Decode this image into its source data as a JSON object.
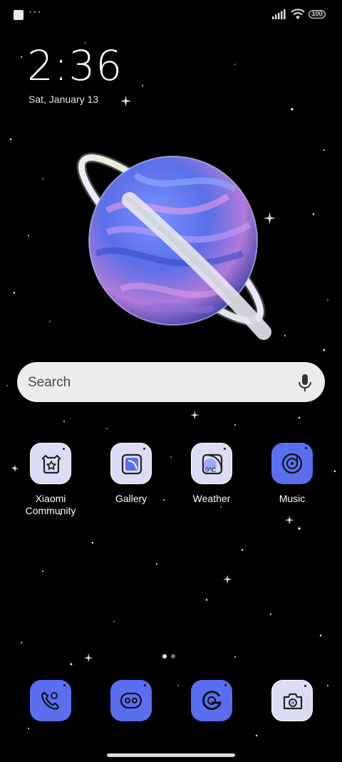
{
  "status_bar": {
    "overflow_dots": "···",
    "battery": "100",
    "icons": [
      "notification-square-icon",
      "signal-icon",
      "wifi-icon",
      "battery-icon"
    ]
  },
  "clock": {
    "time": "2:36",
    "date": "Sat, January 13"
  },
  "search": {
    "placeholder": "Search",
    "icon": "mic-icon"
  },
  "apps": [
    {
      "label": "Xiaomi Community",
      "icon": "xiaomi-community-icon",
      "style": "light"
    },
    {
      "label": "Gallery",
      "icon": "gallery-icon",
      "style": "light"
    },
    {
      "label": "Weather",
      "icon": "weather-icon",
      "style": "light",
      "badge": "0°C"
    },
    {
      "label": "Music",
      "icon": "music-icon",
      "style": "blue"
    }
  ],
  "dock": [
    {
      "icon": "phone-icon",
      "style": "blue"
    },
    {
      "icon": "messages-icon",
      "style": "blue"
    },
    {
      "icon": "chrome-icon",
      "style": "blue"
    },
    {
      "icon": "camera-icon",
      "style": "light"
    }
  ],
  "pages": {
    "total": 2,
    "current": 1
  },
  "colors": {
    "accent_blue": "#5a6ef0",
    "tile_light": "#dcdcf6",
    "background": "#000000"
  }
}
